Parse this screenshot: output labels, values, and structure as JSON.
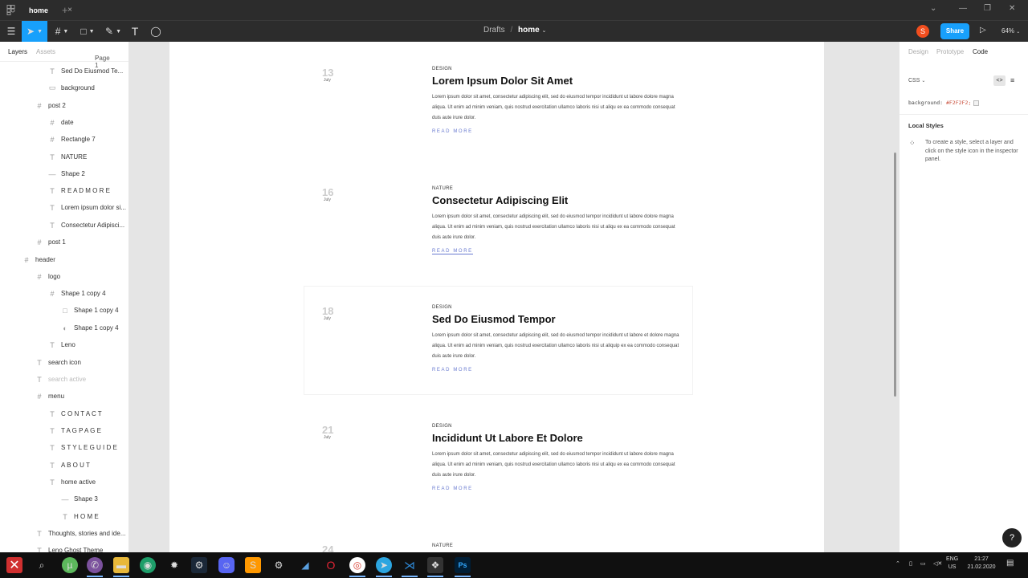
{
  "titlebar": {
    "tab_label": "home",
    "close": "×",
    "plus": "+"
  },
  "toolbar": {
    "breadcrumb_parent": "Drafts",
    "breadcrumb_sep": "/",
    "breadcrumb_current": "home",
    "avatar_initial": "S",
    "share_label": "Share",
    "zoom_label": "64%"
  },
  "left_panel": {
    "tab_layers": "Layers",
    "tab_assets": "Assets",
    "page_label": "Page 1",
    "layers": [
      {
        "label": "Sed Do Eiusmod Te...",
        "icon": "text-icon"
      },
      {
        "label": "background",
        "icon": "rectangle-icon"
      },
      {
        "label": "post 2",
        "icon": "frame-icon"
      },
      {
        "label": "date",
        "icon": "frame-icon"
      },
      {
        "label": "Rectangle 7",
        "icon": "frame-icon"
      },
      {
        "label": "NATURE",
        "icon": "text-icon"
      },
      {
        "label": "Shape 2",
        "icon": "line-icon"
      },
      {
        "label": "R E A D   M O R E",
        "icon": "text-icon"
      },
      {
        "label": "Lorem ipsum dolor si...",
        "icon": "text-icon"
      },
      {
        "label": "Consectetur Adipisci...",
        "icon": "text-icon"
      },
      {
        "label": "post 1",
        "icon": "frame-icon"
      },
      {
        "label": "header",
        "icon": "frame-icon"
      },
      {
        "label": "logo",
        "icon": "frame-icon"
      },
      {
        "label": "Shape 1 copy 4",
        "icon": "frame-icon"
      },
      {
        "label": "Shape 1 copy 4",
        "icon": "square-icon"
      },
      {
        "label": "Shape 1 copy 4",
        "icon": "circle-half-icon"
      },
      {
        "label": "Leno",
        "icon": "text-icon"
      },
      {
        "label": "search icon",
        "icon": "text-icon"
      },
      {
        "label": "search active",
        "icon": "text-icon"
      },
      {
        "label": "menu",
        "icon": "frame-icon"
      },
      {
        "label": "C O N T A C T",
        "icon": "text-icon"
      },
      {
        "label": "T A G   P A G E",
        "icon": "text-icon"
      },
      {
        "label": "S T Y L E   G U I D E",
        "icon": "text-icon"
      },
      {
        "label": "A B O U T",
        "icon": "text-icon"
      },
      {
        "label": "home active",
        "icon": "text-icon"
      },
      {
        "label": "Shape 3",
        "icon": "line-icon"
      },
      {
        "label": "H O M E",
        "icon": "text-icon"
      },
      {
        "label": "Thoughts, stories and ide...",
        "icon": "text-icon"
      },
      {
        "label": "Leno Ghost Theme",
        "icon": "text-icon"
      }
    ]
  },
  "posts": [
    {
      "day": "13",
      "month": "July",
      "category": "DESIGN",
      "title": "Lorem Ipsum Dolor Sit Amet",
      "body": "Lorem ipsum dolor sit amet, consectetur adipiscing elit, sed do eiusmod tempor incididunt ut labore dolore magna aliqua. Ut enim ad minim veniam, quis nostrud exercitation ullamco laboris nisi ut aliqu ex ea commodo consequat duis aute irure dolor.",
      "more": "READ MORE"
    },
    {
      "day": "16",
      "month": "July",
      "category": "NATURE",
      "title": "Consectetur Adipiscing Elit",
      "body": "Lorem ipsum dolor sit amet, consectetur adipiscing elit, sed do eiusmod tempor incididunt ut labore dolore magna aliqua. Ut enim ad minim veniam, quis nostrud exercitation ullamco laboris nisi ut aliqu ex ea commodo consequat duis aute irure dolor.",
      "more": "READ MORE"
    },
    {
      "day": "18",
      "month": "July",
      "category": "DESIGN",
      "title": "Sed Do Eiusmod Tempor",
      "body": "Lorem ipsum dolor sit amet, consectetur adipiscing elit, sed do eiusmod tempor incididunt ut labore et dolore magna aliqua. Ut enim ad minim veniam, quis nostrud exercitation ullamco laboris nisi ut aliquip ex ea commodo consequat duis aute irure dolor.",
      "more": "READ MORE"
    },
    {
      "day": "21",
      "month": "July",
      "category": "DESIGN",
      "title": "Incididunt Ut Labore Et Dolore",
      "body": "Lorem ipsum dolor sit amet, consectetur adipiscing elit, sed do eiusmod tempor incididunt ut labore dolore magna aliqua. Ut enim ad minim veniam, quis nostrud exercitation ullamco laboris nisi ut aliqu ex ea commodo consequat duis aute irure dolor.",
      "more": "READ MORE"
    },
    {
      "day": "24",
      "month": "",
      "category": "NATURE",
      "title": "",
      "body": "",
      "more": ""
    }
  ],
  "right_panel": {
    "tab_design": "Design",
    "tab_prototype": "Prototype",
    "tab_code": "Code",
    "lang_label": "CSS",
    "code_prop": "background:",
    "code_value": "#F2F2F2;",
    "local_styles_heading": "Local Styles",
    "local_styles_text": "To create a style, select a layer and click on the style icon in the inspector panel."
  },
  "help_label": "?",
  "taskbar": {
    "lang_top": "ENG",
    "lang_bottom": "US",
    "time": "21:27",
    "date": "21.02.2020"
  },
  "colors": {
    "accent": "#18a0fb",
    "toolbar_bg": "#2c2c2c",
    "canvas_bg": "#e5e5e5",
    "avatar": "#f24e1e",
    "read_more": "#6a7bd0"
  }
}
